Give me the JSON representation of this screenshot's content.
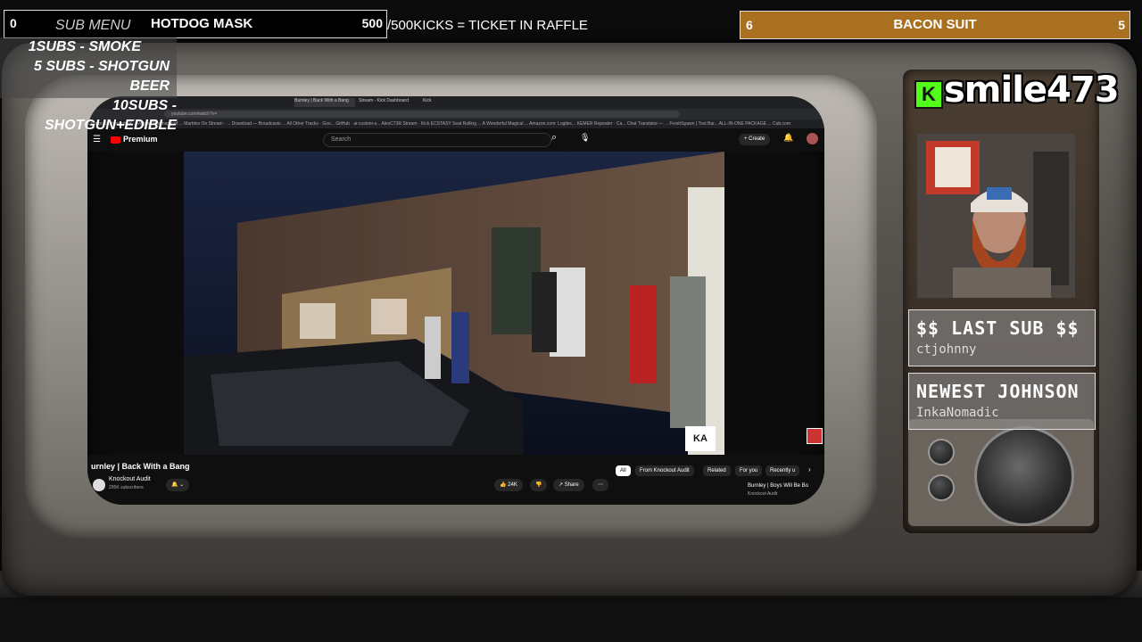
{
  "top_left_bar": {
    "left_number": "0",
    "sub_menu_label": "SUB MENU",
    "goal_label": "HOTDOG MASK",
    "goal_number": "500"
  },
  "kicks_text": "/500KICKS = TICKET IN RAFFLE",
  "top_right_bar": {
    "left_number": "6",
    "goal_label": "BACON SUIT",
    "right_number": "5"
  },
  "sub_menu_items": [
    "1SUBS  - SMOKE",
    "5 SUBS  - SHOTGUN BEER",
    "10SUBS - SHOTGUN+EDIBLE"
  ],
  "streamer": {
    "name": "smile473",
    "platform_icon": "kick-logo-icon"
  },
  "last_sub": {
    "title": "$$ LAST SUB $$",
    "value": "ctjohnny"
  },
  "newest": {
    "title": "NEWEST JOHNSON",
    "value": "InkaNomadic"
  },
  "browser": {
    "tabs": [
      "",
      "",
      "Burnley | Back With a Bang",
      "Stream - Kick Dashboard",
      "Kick"
    ],
    "url": "youtube.com/watch?v=",
    "bookmarks": "Creator Dashboard · K...   Vegas: The magic of ...   Marbles On Stream · ...   Download — Broadcasts ...   All Other Tracks · Goo...   GitHub · ai-custom-s...   AlexC73R Stream · Kick   ECSTASY Seat Rolling ...   A Wonderful Magical ...   Amazon.com: Logitec...   KEMER Repeater · Ca...   Chat Translator — ...   FreshSpawn | Tool Bar...   ALL-IN-ONE PACKAGE ...   Cub.com",
    "youtube_label": "Premium",
    "search_placeholder": "Search",
    "create_label": "Create",
    "video_title": "urnley | Back With a Bang",
    "channel_name": "Knockout Audit",
    "subscribers": "295K subscribers",
    "likes": "24K",
    "share_label": "Share",
    "watermark": "KA",
    "chips": [
      "All",
      "From Knockout Audit",
      "Related",
      "For you",
      "Recently u"
    ],
    "next_video_title": "Burnley | Boys Will Be Bo",
    "next_video_channel": "Knockout Audit"
  }
}
